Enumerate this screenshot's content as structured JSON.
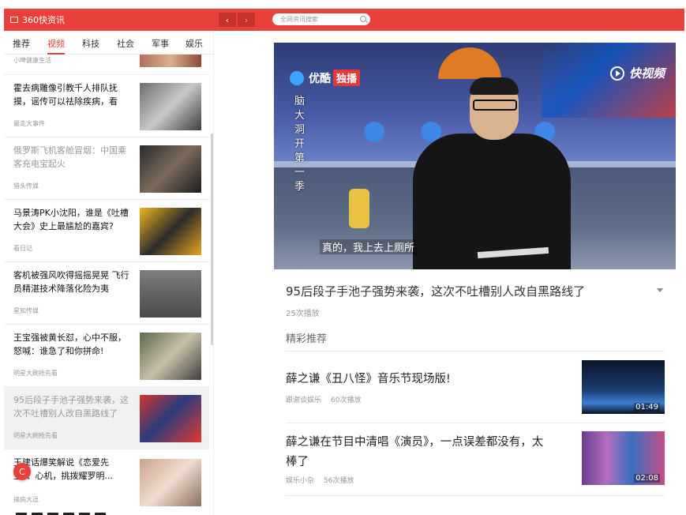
{
  "app": {
    "title": "360快资讯"
  },
  "search": {
    "placeholder": "全网资讯搜索"
  },
  "nav": {
    "back": "‹",
    "forward": "›"
  },
  "tabs": [
    "推荐",
    "视频",
    "科技",
    "社会",
    "军事",
    "娱乐"
  ],
  "active_tab": "视频",
  "list": {
    "partial_top_source": "小啤健康生活",
    "items": [
      {
        "title": "霍去病雕像引教千人排队抚摸，谣传可以祛除疾病，看",
        "source": "最走大事件",
        "read": false
      },
      {
        "title": "俄罗斯飞机客舱冒烟：中国乘客充电宝起火",
        "source": "猎头传媒",
        "read": true
      },
      {
        "title": "马景涛PK小沈阳，谁是《吐槽大会》史上最尴尬的嘉宾?",
        "source": "看日记",
        "read": false
      },
      {
        "title": "客机被强风吹得摇摇晃晃 飞行员精湛技术降落化险为夷",
        "source": "星知传媒",
        "read": false
      },
      {
        "title": "王宝强被黄长怼，心中不服，怒喊：谁急了和你拼命!",
        "source": "明星大刷抢先看",
        "read": false
      },
      {
        "title": "95后段子手池子强势来袭，这次不吐槽别人改自黑路线了",
        "source": "明星大刷抢先看",
        "read": true
      },
      {
        "title": "王建话爆笑解说《恋爱先生》：心机，挑拨耀罗明...",
        "source": "搞病大逗",
        "read": false
      }
    ]
  },
  "fab": {
    "label": "C"
  },
  "player": {
    "logo_left": "优酷",
    "logo_left_badge": "独播",
    "logo_right": "快视频",
    "vertical_text": "脑大洞开第一季",
    "subtitle": "真的，我上去上厕所"
  },
  "video": {
    "title": "95后段子手池子强势来袭，这次不吐槽别人改自黑路线了",
    "views": "25次播放"
  },
  "section_title": "精彩推荐",
  "recommendations": [
    {
      "title": "薛之谦《丑八怪》音乐节现场版!",
      "source": "跟谢谈娱乐",
      "views": "60次播放",
      "duration": "01:49"
    },
    {
      "title": "薛之谦在节目中清唱《演员》，一点误差都没有，太棒了",
      "source": "娱乐小杂",
      "views": "56次播放",
      "duration": "02:08"
    }
  ],
  "colors": {
    "brand": "#e8403a"
  }
}
